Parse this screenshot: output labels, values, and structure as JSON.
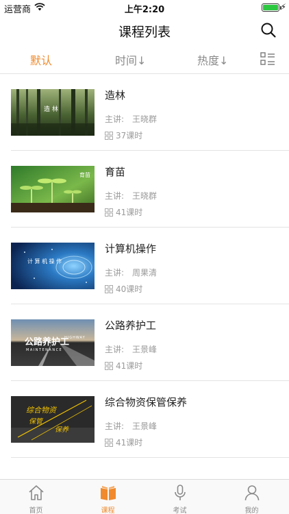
{
  "status_bar": {
    "carrier": "运营商",
    "time": "上午2:20"
  },
  "nav": {
    "title": "课程列表"
  },
  "filters": [
    {
      "label": "默认",
      "active": true
    },
    {
      "label": "时间↓",
      "active": false
    },
    {
      "label": "热度↓",
      "active": false
    }
  ],
  "courses": [
    {
      "title": "造林",
      "lecturer_label": "主讲:",
      "lecturer": "王晓群",
      "hours": "37课时",
      "thumb_text": "造 林"
    },
    {
      "title": "育苗",
      "lecturer_label": "主讲:",
      "lecturer": "王晓群",
      "hours": "41课时",
      "thumb_text": "育苗"
    },
    {
      "title": "计算机操作",
      "lecturer_label": "主讲:",
      "lecturer": "周果清",
      "hours": "40课时",
      "thumb_text": "计 算 机 操 作"
    },
    {
      "title": "公路养护工",
      "lecturer_label": "主讲:",
      "lecturer": "王景峰",
      "hours": "41课时",
      "thumb_text": "公路养护工",
      "thumb_text_en": "MAINTENANCE",
      "thumb_text_en2": "HIGHWAY"
    },
    {
      "title": "综合物资保管保养",
      "lecturer_label": "主讲:",
      "lecturer": "王景峰",
      "hours": "41课时",
      "thumb_text": "综合物资",
      "thumb_text_2": "保管",
      "thumb_text_3": "保养"
    }
  ],
  "tab_bar": [
    {
      "label": "首页",
      "icon": "home-icon",
      "active": false
    },
    {
      "label": "课程",
      "icon": "book-icon",
      "active": true
    },
    {
      "label": "考试",
      "icon": "microphone-icon",
      "active": false
    },
    {
      "label": "我的",
      "icon": "user-icon",
      "active": false
    }
  ],
  "colors": {
    "accent": "#f08a2c",
    "muted": "#8a8a8a",
    "divider": "#e3e3e3"
  }
}
